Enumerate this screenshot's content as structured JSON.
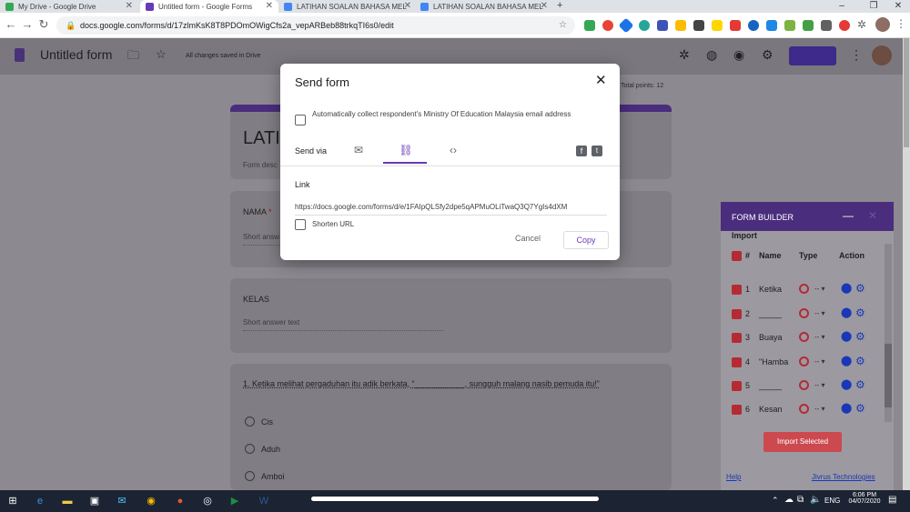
{
  "browser": {
    "tabs": [
      {
        "label": "My Drive - Google Drive",
        "active": false,
        "color": "#34a853"
      },
      {
        "label": "Untitled form - Google Forms",
        "active": true,
        "color": "#673ab7"
      },
      {
        "label": "LATIHAN SOALAN BAHASA MEL",
        "active": false,
        "color": "#4285f4"
      },
      {
        "label": "LATIHAN SOALAN BAHASA MEL",
        "active": false,
        "color": "#4285f4"
      }
    ],
    "new_tab": "+",
    "url": "docs.google.com/forms/d/17zlmKsK8T8PDOmOWigCfs2a_vepARBeb88trkqTI6s0/edit"
  },
  "form_header": {
    "title": "Untitled form",
    "saved_status": "All changes saved in Drive",
    "total_points": "Total points: 12"
  },
  "form": {
    "title_partial": "LATI",
    "description_partial": "Form desc",
    "question_nama": "NAMA",
    "required_mark": "*",
    "short_answer_partial": "Short answ",
    "question_kelas": "KELAS",
    "short_answer": "Short answer text",
    "question_1": "1. Ketika melihat pergaduhan itu adik berkata, “___________, sungguh malang nasib pemuda itu!”",
    "options": [
      "Cis",
      "Aduh",
      "Amboi"
    ]
  },
  "modal": {
    "title": "Send form",
    "collect_email_label": "Automatically collect respondent's Ministry Of Education Malaysia email address",
    "send_via_label": "Send via",
    "link_heading": "Link",
    "link_url": "https://docs.google.com/forms/d/e/1FAIpQLSfy2dpe5qAPMuOLiTwaQ3Q7YgIs4dXM",
    "shorten_url_label": "Shorten URL",
    "cancel_label": "Cancel",
    "copy_label": "Copy",
    "accent_color": "#673ab7"
  },
  "form_builder": {
    "title": "FORM BUILDER",
    "import_partial": "Import",
    "columns": [
      "#",
      "Name",
      "Type",
      "Action"
    ],
    "rows": [
      {
        "num": "1",
        "name": "Ketika"
      },
      {
        "num": "2",
        "name": "_____"
      },
      {
        "num": "3",
        "name": "Buaya"
      },
      {
        "num": "4",
        "name": "\"Hamba"
      },
      {
        "num": "5",
        "name": "_____"
      },
      {
        "num": "6",
        "name": "Kesan"
      }
    ],
    "type_dash": "-- ▾",
    "import_button": "Import Selected",
    "help_link": "Help",
    "credit": "Jivrus Technologies"
  },
  "taskbar": {
    "time": "6:06 PM",
    "date": "04/07/2020",
    "language": "ENG"
  }
}
